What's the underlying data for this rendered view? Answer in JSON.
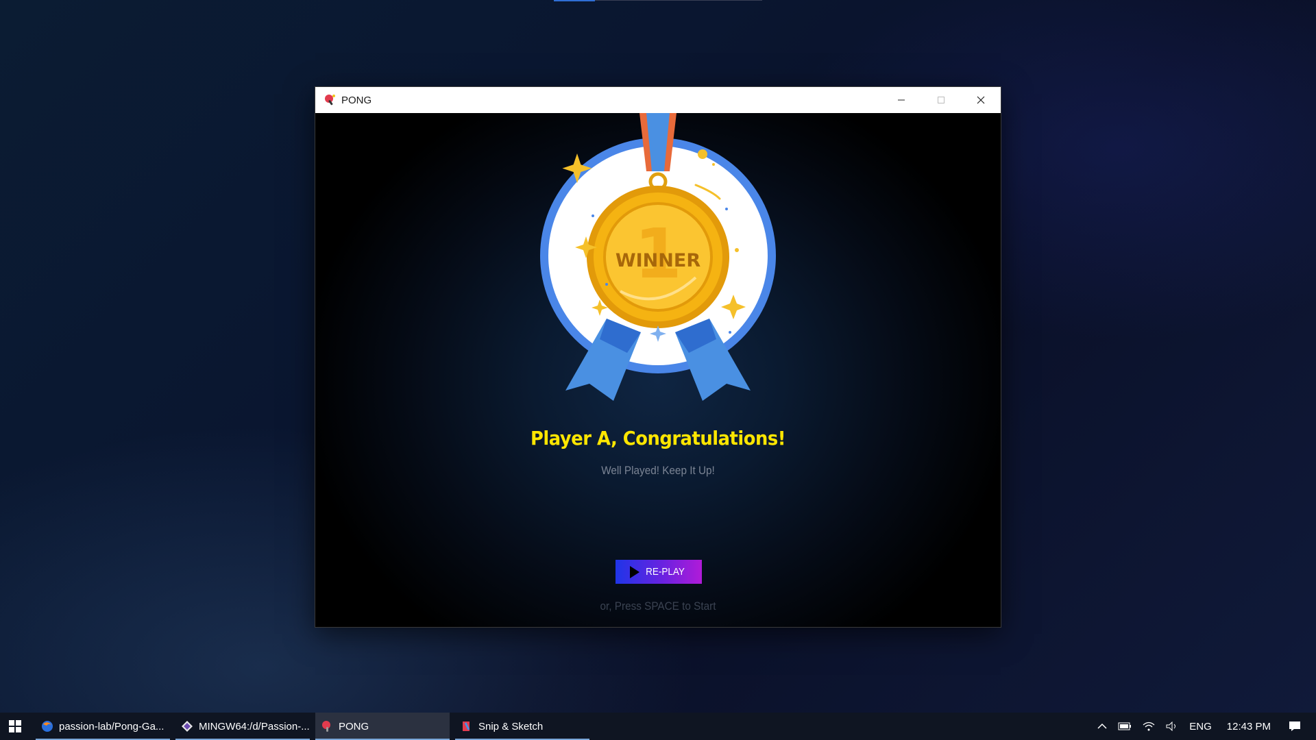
{
  "window": {
    "title": "PONG",
    "minimize_glyph": "—",
    "maximize_glyph": "☐",
    "close_glyph": "✕"
  },
  "game": {
    "medal_text": "WINNER",
    "medal_number": "1",
    "headline": "Player A, Congratulations!",
    "subline": "Well Played! Keep It Up!",
    "replay_label": "RE-PLAY",
    "hint": "or, Press SPACE to Start"
  },
  "taskbar": {
    "items": [
      {
        "label": "passion-lab/Pong-Ga...",
        "icon": "firefox-icon"
      },
      {
        "label": "MINGW64:/d/Passion-...",
        "icon": "git-bash-icon"
      },
      {
        "label": "PONG",
        "icon": "pong-icon"
      },
      {
        "label": "Snip & Sketch",
        "icon": "snip-sketch-icon"
      }
    ],
    "tray": {
      "language": "ENG",
      "time": "12:43 PM"
    }
  },
  "colors": {
    "headline": "#ffe600",
    "replay_gradient_start": "#1f35e8",
    "replay_gradient_end": "#b01bd8",
    "medal_gold": "#f5b312",
    "ribbon_blue": "#4a90e2"
  }
}
